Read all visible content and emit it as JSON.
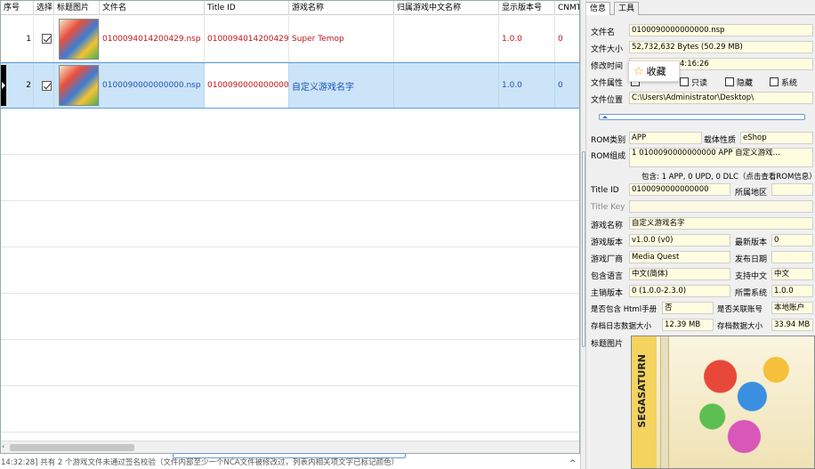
{
  "grid": {
    "columns": [
      "序号",
      "选择",
      "标题图片",
      "文件名",
      "Title ID",
      "游戏名称",
      "归属游戏中文名称",
      "显示版本号",
      "CNMT"
    ],
    "rows": [
      {
        "index": "1",
        "file": "0100094014200429.nsp",
        "title_id": "0100094014200429",
        "game": "Super Temop",
        "cn_name": "",
        "version": "1.0.0",
        "cnmt": "0"
      },
      {
        "index": "2",
        "file": "0100090000000000.nsp",
        "title_id": "0100090000000000",
        "game": "自定义游戏名字",
        "cn_name": "",
        "version": "1.0.0",
        "cnmt": "0"
      }
    ]
  },
  "status": {
    "text": "14:32:28] 共有 2 个游戏文件未通过签名校验（文件内部至少一个NCA文件被修改过，列表内相关项文字已标记颜色）"
  },
  "tabs": [
    "信息",
    "工具"
  ],
  "fav": {
    "label": "收藏"
  },
  "info": {
    "filename_label": "文件名",
    "filename": "0100090000000000.nsp",
    "size_label": "文件大小",
    "size": "52,732,632 Bytes (50.29 MB)",
    "mtime_label": "修改时间",
    "mtime": "4:16:26",
    "attr_label": "文件属性",
    "attr_readonly": "只读",
    "attr_hidden": "隐藏",
    "attr_system": "系统",
    "loc_label": "文件位置",
    "loc": "C:\\Users\\Administrator\\Desktop\\",
    "romtype_label": "ROM类别",
    "romtype": "APP",
    "carrier_label": "载体性质",
    "carrier": "eShop",
    "romcomp_label": "ROM组成",
    "romcomp": "1  0100090000000000  APP  自定义游戏...",
    "contains": "包含: 1 APP, 0 UPD, 0 DLC（点击查看ROM信息）",
    "titleid_label": "Title ID",
    "titleid": "0100090000000000",
    "region_label": "所属地区",
    "region": "",
    "titlekey_label": "Title Key",
    "titlekey": "",
    "gamename_label": "游戏名称",
    "gamename": "自定义游戏名字",
    "gamever_label": "游戏版本",
    "gamever": "v1.0.0 (v0)",
    "latest_label": "最新版本",
    "latest": "0",
    "publisher_label": "游戏厂商",
    "publisher": "Media Quest",
    "release_label": "发布日期",
    "release": "",
    "lang_label": "包含语言",
    "lang": "中文(简体)",
    "cn_label": "支持中文",
    "cn": "中文",
    "mainver_label": "主销版本",
    "mainver": "0 (1.0.0-2.3.0)",
    "sysreq_label": "所需系统",
    "sysreq": "1.0.0",
    "html_label": "是否包含 Html手册",
    "html": "否",
    "linked_label": "是否关联账号",
    "linked": "本地账户",
    "logsize_label": "存档日志数据大小",
    "logsize": "12.39 MB",
    "savesize_label": "存档数据大小",
    "savesize": "33.94 MB",
    "cover_label": "标题图片"
  },
  "cover": {
    "brand": "SEGASATURN",
    "colors": [
      "#f4d35e",
      "#e8483a",
      "#3a8fe0",
      "#5cbf52"
    ]
  },
  "colors": {
    "row_selected": "#cce4f7",
    "signature_fail_red": "#c0141a",
    "signature_fail_blue": "#1a52b8",
    "field_bg": "#fffde0"
  }
}
